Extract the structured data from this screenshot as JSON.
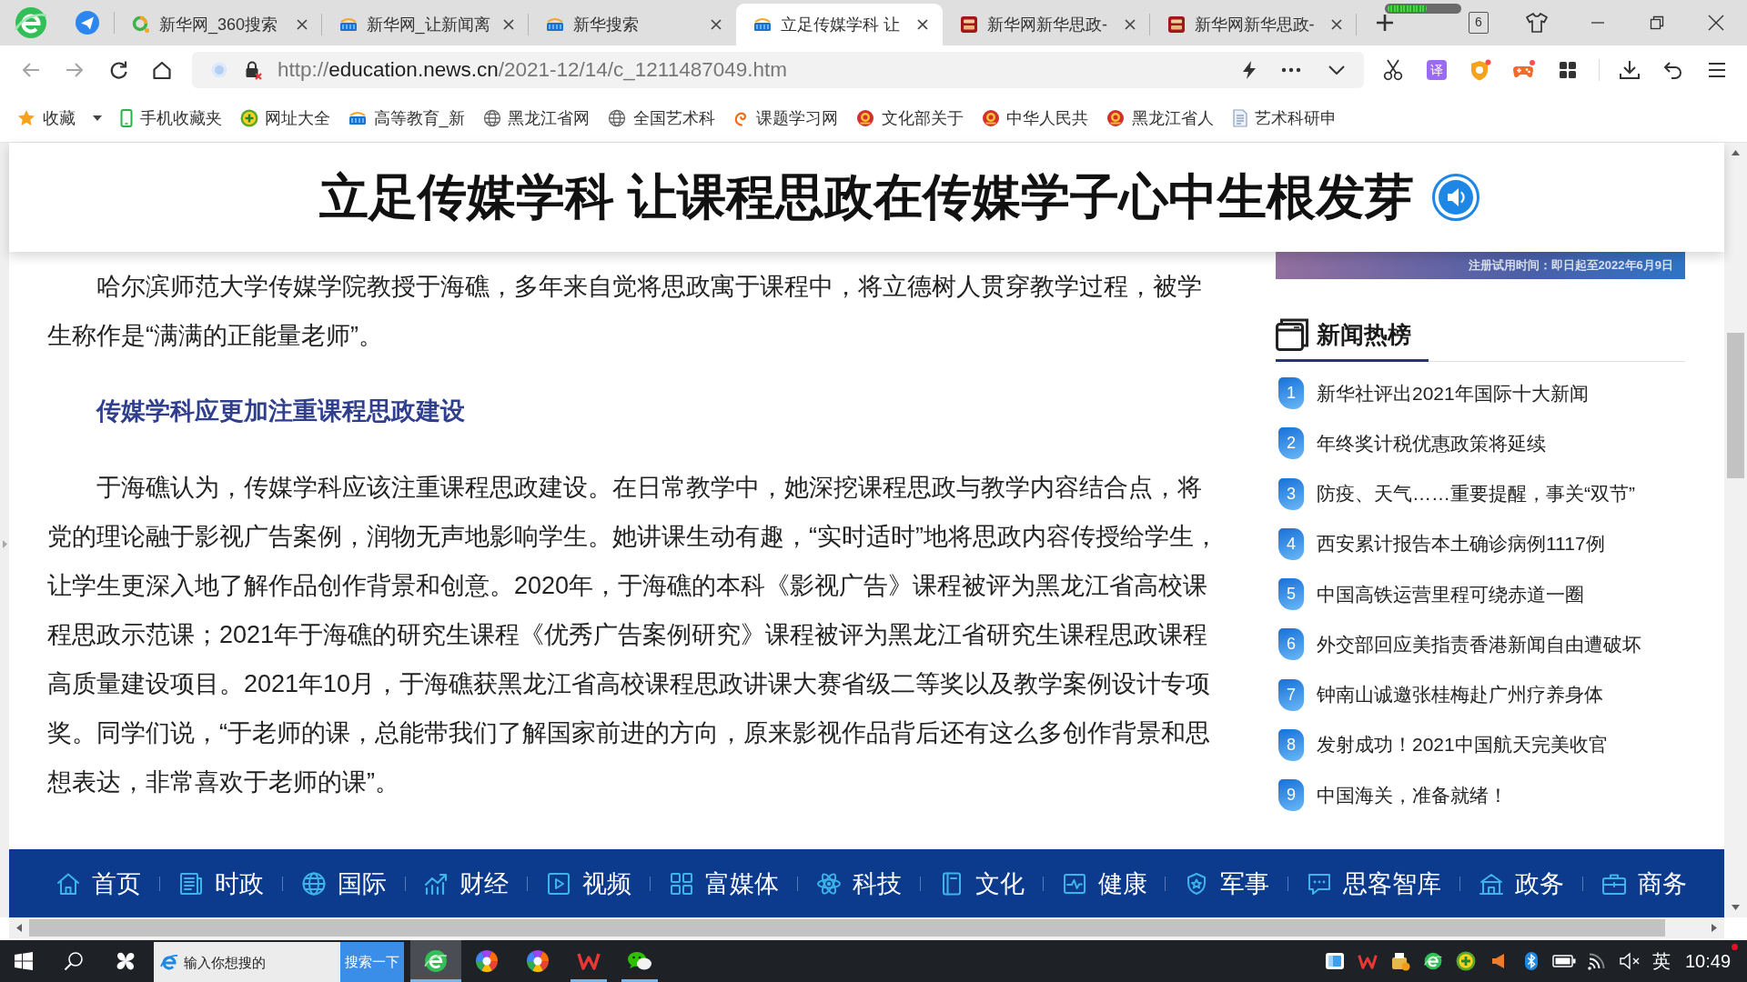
{
  "tab_bar": {
    "tabs": [
      {
        "title": "新华网_360搜索",
        "kind": "search360",
        "selected": false
      },
      {
        "title": "新华网_让新闻离",
        "kind": "news",
        "selected": false
      },
      {
        "title": "新华搜索",
        "kind": "news",
        "selected": false
      },
      {
        "title": "立足传媒学科 让",
        "kind": "news",
        "selected": true
      },
      {
        "title": "新华网新华思政-",
        "kind": "square",
        "selected": false
      },
      {
        "title": "新华网新华思政-",
        "kind": "square",
        "selected": false
      }
    ],
    "meter": {
      "level": 0.55
    },
    "tab_count": "6"
  },
  "toolbar": {
    "nav_buttons": [
      {
        "kind": "back",
        "disabled": true
      },
      {
        "kind": "forward",
        "disabled": true
      },
      {
        "kind": "reload",
        "disabled": false
      },
      {
        "kind": "home",
        "disabled": false
      }
    ],
    "address": {
      "scheme": "http://",
      "host": "education.news.cn",
      "path": "/2021-12/14/c_1211487049.htm"
    },
    "translate_label": "译"
  },
  "bookmarks": [
    {
      "label": "收藏",
      "kind": "favorites"
    },
    {
      "label": "手机收藏夹",
      "kind": "phone"
    },
    {
      "label": "网址大全",
      "kind": "plus"
    },
    {
      "label": "高等教育_新",
      "kind": "news"
    },
    {
      "label": "黑龙江省网",
      "kind": "globe"
    },
    {
      "label": "全国艺术科",
      "kind": "globe"
    },
    {
      "label": "课题学习网",
      "kind": "swirl"
    },
    {
      "label": "文化部关于",
      "kind": "emblem"
    },
    {
      "label": "中华人民共",
      "kind": "emblem"
    },
    {
      "label": "黑龙江省人",
      "kind": "emblem"
    },
    {
      "label": "艺术科研申",
      "kind": "document"
    }
  ],
  "page": {
    "title": "立足传媒学科 让课程思政在传媒学子心中生根发芽",
    "article": [
      {
        "kind": "paragraph",
        "text": "哈尔滨师范大学传媒学院教授于海礁，多年来自觉将思政寓于课程中，将立德树人贯穿教学过程，被学生称作是“满满的正能量老师”。"
      },
      {
        "kind": "heading",
        "text": "传媒学科应更加注重课程思政建设"
      },
      {
        "kind": "paragraph",
        "text": "于海礁认为，传媒学科应该注重课程思政建设。在日常教学中，她深挖课程思政与教学内容结合点，将党的理论融于影视广告案例，润物无声地影响学生。她讲课生动有趣，“实时适时”地将思政内容传授给学生，让学生更深入地了解作品创作背景和创意。2020年，于海礁的本科《影视广告》课程被评为黑龙江省高校课程思政示范课；2021年于海礁的研究生课程《优秀广告案例研究》课程被评为黑龙江省研究生课程思政课程高质量建设项目。2021年10月，于海礁获黑龙江省高校课程思政讲课大赛省级二等奖以及教学案例设计专项奖。同学们说，“于老师的课，总能带我们了解国家前进的方向，原来影视作品背后还有这么多创作背景和思想表达，非常喜欢于老师的课”。"
      }
    ],
    "sidebar": {
      "banner_text": "注册试用时间：即日起至2022年6月9日",
      "hot_news": {
        "title": "新闻热榜",
        "items": [
          {
            "rank": "1",
            "title": "新华社评出2021年国际十大新闻"
          },
          {
            "rank": "2",
            "title": "年终奖计税优惠政策将延续"
          },
          {
            "rank": "3",
            "title": "防疫、天气……重要提醒，事关“双节”"
          },
          {
            "rank": "4",
            "title": "西安累计报告本土确诊病例1117例"
          },
          {
            "rank": "5",
            "title": "中国高铁运营里程可绕赤道一圈"
          },
          {
            "rank": "6",
            "title": "外交部回应美指责香港新闻自由遭破坏"
          },
          {
            "rank": "7",
            "title": "钟南山诚邀张桂梅赴广州疗养身体"
          },
          {
            "rank": "8",
            "title": "发射成功！2021中国航天完美收官"
          },
          {
            "rank": "9",
            "title": "中国海关，准备就绪！"
          }
        ]
      }
    },
    "nav": [
      {
        "label": "首页",
        "kind": "home"
      },
      {
        "label": "时政",
        "kind": "newspaper"
      },
      {
        "label": "国际",
        "kind": "globe"
      },
      {
        "label": "财经",
        "kind": "chart"
      },
      {
        "label": "视频",
        "kind": "video"
      },
      {
        "label": "富媒体",
        "kind": "grid"
      },
      {
        "label": "科技",
        "kind": "atom"
      },
      {
        "label": "文化",
        "kind": "book"
      },
      {
        "label": "健康",
        "kind": "pulse"
      },
      {
        "label": "军事",
        "kind": "shield"
      },
      {
        "label": "思客智库",
        "kind": "chat"
      },
      {
        "label": "政务",
        "kind": "building"
      },
      {
        "label": "商务",
        "kind": "briefcase"
      }
    ]
  },
  "taskbar": {
    "search": {
      "placeholder": "输入你想搜的",
      "button": "搜索一下"
    },
    "apps": [
      {
        "kind": "browser",
        "open": true,
        "selected": true
      },
      {
        "kind": "wheel",
        "open": false,
        "selected": false
      },
      {
        "kind": "wheel",
        "open": false,
        "selected": false
      },
      {
        "kind": "office",
        "open": true,
        "selected": false
      },
      {
        "kind": "chat",
        "open": true,
        "selected": false
      }
    ],
    "ime": "英",
    "time": "10:49"
  }
}
